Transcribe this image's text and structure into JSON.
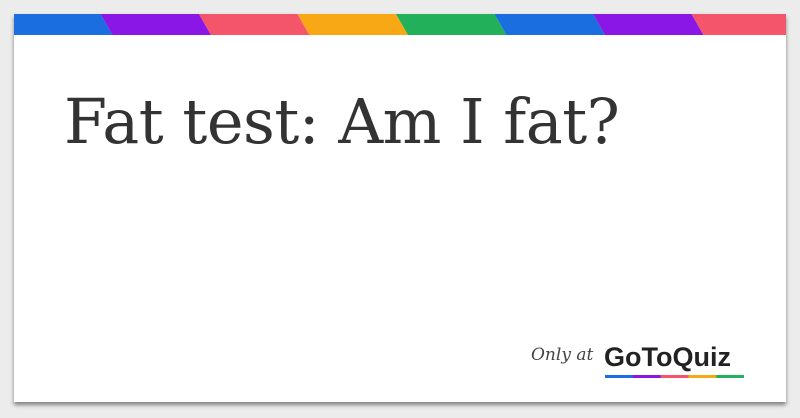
{
  "title": "Fat test: Am I fat?",
  "brand": {
    "prefix": "Only at",
    "name": "GoToQuiz"
  },
  "colors": {
    "stripe": [
      "#1a6ee0",
      "#8a17e6",
      "#f5556b",
      "#f8a715",
      "#22b15a",
      "#1a6ee0",
      "#8a17e6",
      "#f5556b"
    ],
    "title_text": "#333333",
    "card_background": "#ffffff",
    "page_background": "#ececec"
  }
}
